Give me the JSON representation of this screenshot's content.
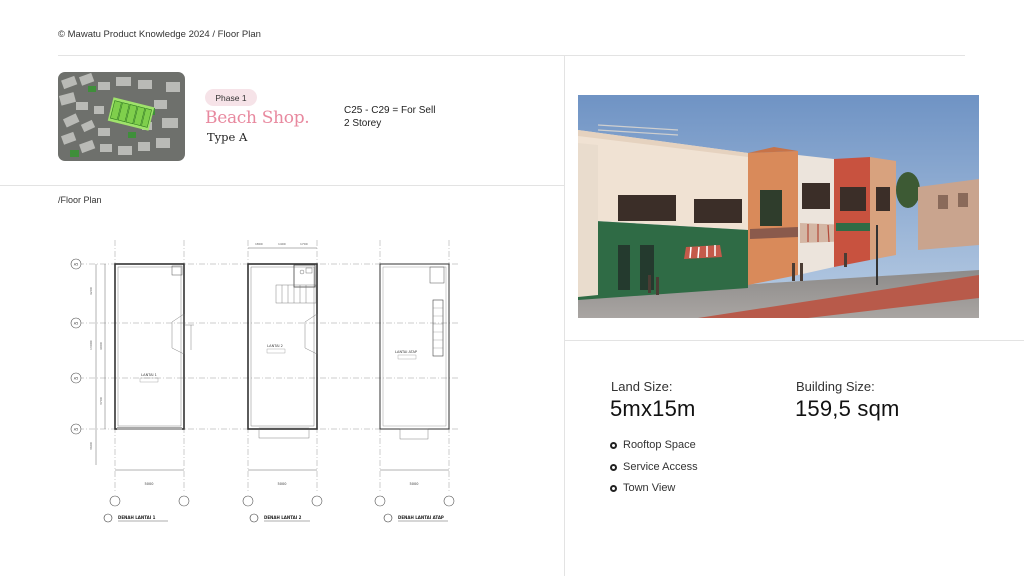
{
  "breadcrumb": "© Mawatu Product Knowledge 2024  / Floor Plan",
  "header": {
    "phase": "Phase 1",
    "title": "Beach Shop.",
    "type": "Type A",
    "units": "C25 - C29 = For Sell",
    "storey": "2 Storey"
  },
  "floor_plan": {
    "section_label": "/Floor Plan",
    "plans": [
      {
        "caption": "DENAH LANTAI 1",
        "room": "LANTAI 1",
        "width_dim": "5000"
      },
      {
        "caption": "DENAH LANTAI 2",
        "room": "LANTAI 2",
        "width_dim": "5000"
      },
      {
        "caption": "DENAH LANTAI ATAP",
        "room": "LANTAI ATAP",
        "width_dim": "5000"
      }
    ],
    "grid_labels": [
      "A5",
      "A5",
      "A5",
      "A5"
    ]
  },
  "specs": {
    "land_label": "Land Size:",
    "land_value": "5mx15m",
    "building_label": "Building Size:",
    "building_value": "159,5 sqm"
  },
  "features": [
    "Rooftop Space",
    "Service Access",
    "Town View"
  ],
  "colors": {
    "accent_pink": "#e8899f",
    "badge_bg": "#f6e3e8",
    "facade_green": "#2f6b45",
    "divider": "#e3e3e3"
  }
}
